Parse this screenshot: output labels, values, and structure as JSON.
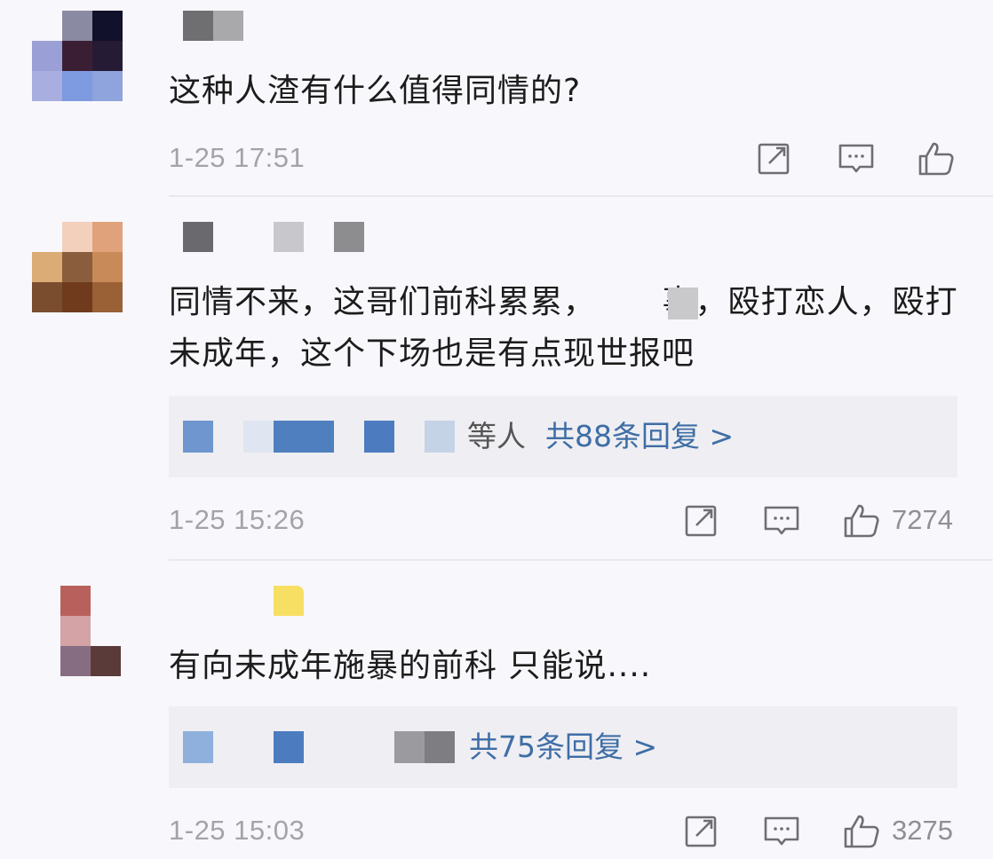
{
  "comments": [
    {
      "text": "这种人渣有什么值得同情的?",
      "time": "1-25 17:51",
      "likes": "",
      "replies": null,
      "avatar_colors": [
        "#f2f1f6",
        "#8a8aa3",
        "#12112b",
        "#9aa0d6",
        "#3a1f34",
        "#261b34",
        "#a8aee0",
        "#7e9ae0",
        "#8fa3dc"
      ]
    },
    {
      "text": "同情不来，这哥们前科累累，      事，殴打恋人，殴打未成年，这个下场也是有点现世报吧",
      "time": "1-25 15:26",
      "likes": "7274",
      "replies": {
        "who": "等人",
        "count_text": "共88条回复 >"
      },
      "avatar_colors": [
        "#f6efea",
        "#f3d0bb",
        "#dfa27a",
        "#dcac76",
        "#8a5e3c",
        "#c98a59",
        "#7b4d2f",
        "#6f3b1c",
        "#9a6137"
      ]
    },
    {
      "text": "有向未成年施暴的前科 只能说....",
      "time": "1-25 15:03",
      "likes": "3275",
      "replies": {
        "who": "",
        "count_text": "共75条回复 >"
      },
      "avatar_colors": [
        "#b8615c",
        "#d3a3a5",
        "#876d82",
        "#5a3b3a"
      ]
    }
  ],
  "icons": {
    "share": "share-icon",
    "comment": "comment-icon",
    "like": "thumbs-up-icon"
  }
}
